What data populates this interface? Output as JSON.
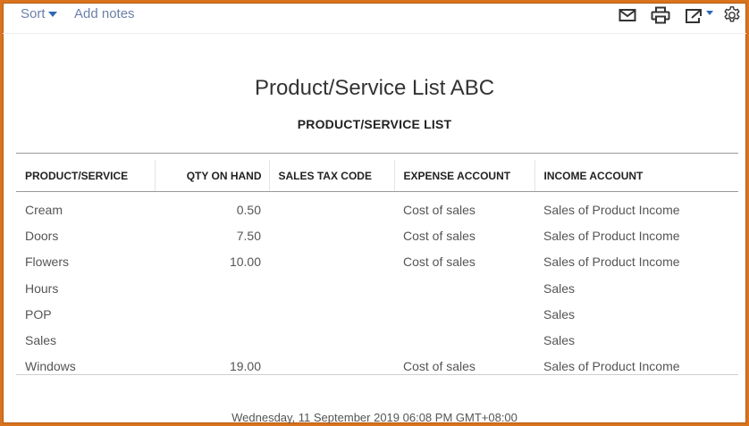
{
  "toolbar": {
    "sort_label": "Sort",
    "add_notes_label": "Add notes",
    "icons": [
      "mail-icon",
      "print-icon",
      "export-icon",
      "gear-icon"
    ]
  },
  "report": {
    "title": "Product/Service List ABC",
    "subtitle": "PRODUCT/SERVICE LIST",
    "columns": [
      "PRODUCT/SERVICE",
      "QTY ON HAND",
      "SALES TAX CODE",
      "EXPENSE ACCOUNT",
      "INCOME ACCOUNT"
    ],
    "rows": [
      {
        "product": "Cream",
        "qty": "0.50",
        "tax_code": "",
        "expense": "Cost of sales",
        "income": "Sales of Product Income"
      },
      {
        "product": "Doors",
        "qty": "7.50",
        "tax_code": "",
        "expense": "Cost of sales",
        "income": "Sales of Product Income"
      },
      {
        "product": "Flowers",
        "qty": "10.00",
        "tax_code": "",
        "expense": "Cost of sales",
        "income": "Sales of Product Income"
      },
      {
        "product": "Hours",
        "qty": "",
        "tax_code": "",
        "expense": "",
        "income": "Sales"
      },
      {
        "product": "POP",
        "qty": "",
        "tax_code": "",
        "expense": "",
        "income": "Sales"
      },
      {
        "product": "Sales",
        "qty": "",
        "tax_code": "",
        "expense": "",
        "income": "Sales"
      },
      {
        "product": "Windows",
        "qty": "19.00",
        "tax_code": "",
        "expense": "Cost of sales",
        "income": "Sales of Product Income"
      }
    ],
    "footer": "Wednesday, 11 September 2019   06:08 PM GMT+08:00"
  },
  "colors": {
    "frame": "#d9731e",
    "link": "#6b7fa6",
    "caret": "#2f67b6"
  }
}
